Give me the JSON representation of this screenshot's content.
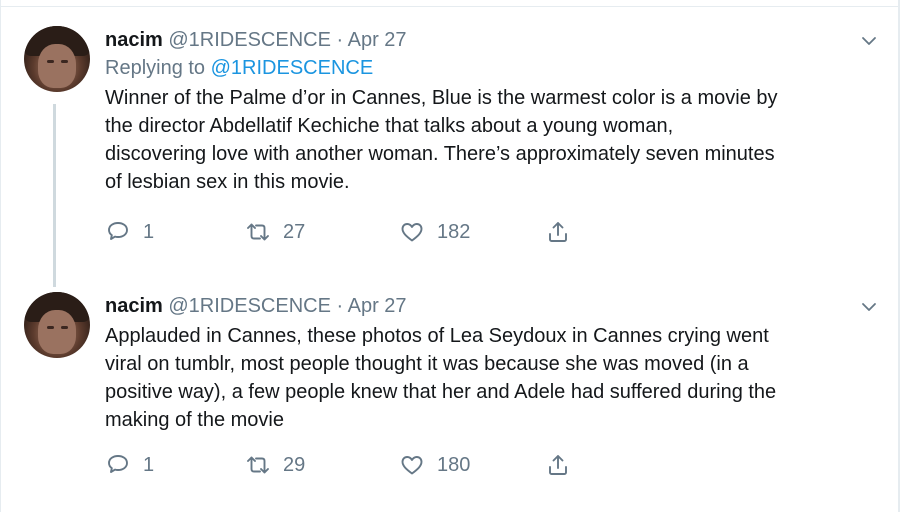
{
  "tweets": [
    {
      "name": "nacim",
      "handle": "@1RIDESCENCE",
      "separator": "·",
      "date": "Apr 27",
      "replying_prefix": "Replying to",
      "replying_to": "@1RIDESCENCE",
      "text": "Winner of the Palme d’or in Cannes, Blue is the warmest color is a movie by\nthe director Abdellatif Kechiche that talks about a young woman,\ndiscovering love with another woman. There’s approximately seven minutes\nof lesbian sex in this movie.",
      "replies": "1",
      "retweets": "27",
      "likes": "182"
    },
    {
      "name": "nacim",
      "handle": "@1RIDESCENCE",
      "separator": "·",
      "date": "Apr 27",
      "text": "Applauded in Cannes, these photos of Lea Seydoux in Cannes crying went\nviral on tumblr, most people thought it was because she was moved (in a\npositive way), a few people knew that her and Adele had suffered during the\nmaking of the movie",
      "replies": "1",
      "retweets": "29",
      "likes": "180"
    }
  ],
  "icons": {
    "reply": "reply-icon",
    "retweet": "retweet-icon",
    "like": "heart-icon",
    "share": "share-icon",
    "menu": "chevron-down-icon"
  },
  "colors": {
    "text": "#14171a",
    "secondary": "#657786",
    "link": "#1b95e0",
    "thread_line": "#cfd9de"
  }
}
